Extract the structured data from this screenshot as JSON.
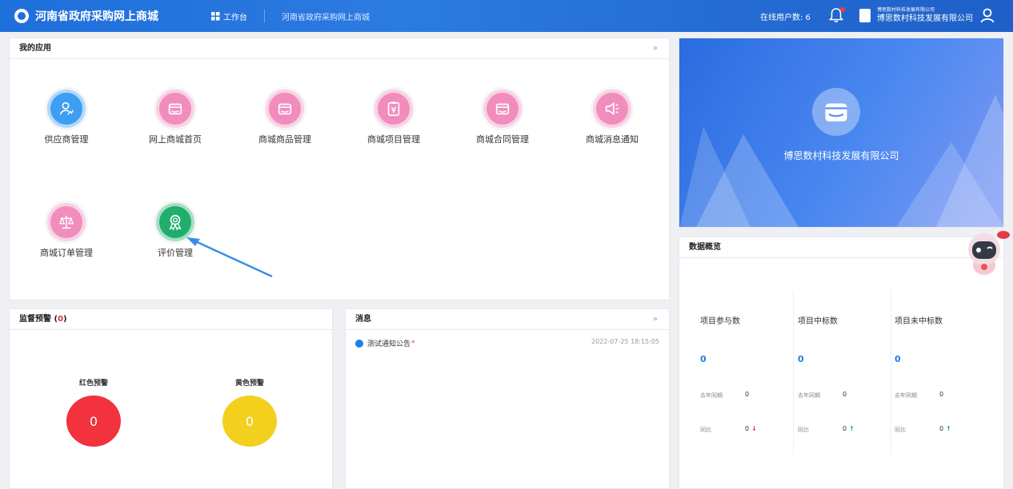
{
  "header": {
    "title": "河南省政府采购网上商城",
    "workbench_label": "工作台",
    "breadcrumb": "河南省政府采购网上商城",
    "online_users": "在线用户数: 6",
    "org_small": "博思数村科技发展有限公司",
    "org_main": "博思数村科技发展有限公司"
  },
  "apps": {
    "title": "我的应用",
    "more": "»",
    "items": [
      {
        "label": "供应商管理",
        "icon": "user-chart-icon",
        "color": "#3d9ef2"
      },
      {
        "label": "网上商城首页",
        "icon": "store-icon",
        "color": "#f08dbd"
      },
      {
        "label": "商城商品管理",
        "icon": "store-icon",
        "color": "#f08dbd"
      },
      {
        "label": "商城项目管理",
        "icon": "clipboard-yen-icon",
        "color": "#f08dbd"
      },
      {
        "label": "商城合同管理",
        "icon": "store-icon",
        "color": "#f08dbd"
      },
      {
        "label": "商城消息通知",
        "icon": "megaphone-icon",
        "color": "#f08dbd"
      },
      {
        "label": "商城订单管理",
        "icon": "scale-icon",
        "color": "#f08dbd"
      },
      {
        "label": "评价管理",
        "icon": "award-icon",
        "color": "#1fae6c"
      }
    ]
  },
  "banner": {
    "company": "博思数村科技发展有限公司"
  },
  "overview": {
    "title": "数据概览",
    "columns": [
      {
        "title": "项目参与数",
        "value": "0",
        "last_year_label": "去年同期",
        "last_year_value": "0",
        "yoy_label": "同比",
        "yoy_value": "0",
        "arrow": "↓",
        "arrow_color": "#e23030"
      },
      {
        "title": "项目中标数",
        "value": "0",
        "last_year_label": "去年同期",
        "last_year_value": "0",
        "yoy_label": "同比",
        "yoy_value": "0",
        "arrow": "↑",
        "arrow_color": "#27ae3c"
      },
      {
        "title": "项目未中标数",
        "value": "0",
        "last_year_label": "去年同期",
        "last_year_value": "0",
        "yoy_label": "同比",
        "yoy_value": "0",
        "arrow": "↑",
        "arrow_color": "#27ae3c"
      }
    ]
  },
  "warnings": {
    "title": "监督预警 (",
    "count": "0",
    "close": ")",
    "red_label": "红色预警",
    "red_value": "0",
    "red_color": "#f2323c",
    "yellow_label": "黄色预警",
    "yellow_value": "0",
    "yellow_color": "#f3cf1e"
  },
  "messages": {
    "title": "消息",
    "more": "»",
    "items": [
      {
        "text": "测试通知公告",
        "marker": "*",
        "time": "2022-07-25 18:15:05"
      }
    ]
  }
}
